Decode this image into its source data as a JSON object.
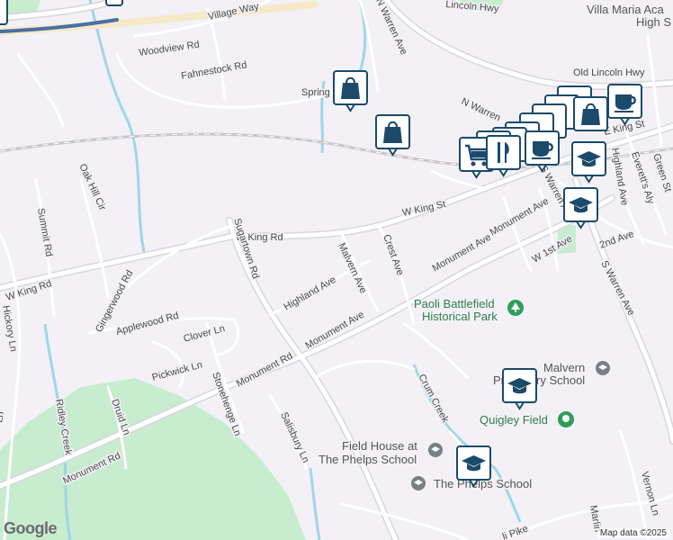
{
  "map": {
    "attribution": "Map data ©2025",
    "logo": "Google",
    "colors": {
      "background": "#f3f1f5",
      "road": "#ffffff",
      "road_casing": "#d9d6de",
      "water": "#9fd6e8",
      "park": "#c8eccf",
      "rail": "#c9c6cf",
      "marker_fill": "#ffffff",
      "marker_border": "#1b4a6b",
      "marker_icon": "#1b4a6b",
      "transit": "#4a6fa5"
    }
  },
  "streets": [
    {
      "text": "Village Way"
    },
    {
      "text": "Woodview Rd"
    },
    {
      "text": "Fahnestock Rd"
    },
    {
      "text": "N Warren Ave"
    },
    {
      "text": "Lincoln Hwy"
    },
    {
      "text": "Old Lincoln Hwy"
    },
    {
      "text": "Spring"
    },
    {
      "text": "N Warren"
    },
    {
      "text": "E King St"
    },
    {
      "text": "W King St"
    },
    {
      "text": "W King Rd"
    },
    {
      "text": "W King Rd"
    },
    {
      "text": "Oak Hill Cir"
    },
    {
      "text": "Summit Rd"
    },
    {
      "text": "Sugartown Rd"
    },
    {
      "text": "Malvern Ave"
    },
    {
      "text": "Crest Ave"
    },
    {
      "text": "Highland Ave"
    },
    {
      "text": "Monument Ave"
    },
    {
      "text": "Monument Ave"
    },
    {
      "text": "Monument Ave"
    },
    {
      "text": "Monument Rd"
    },
    {
      "text": "Monument Rd"
    },
    {
      "text": "Gingerwood Rd"
    },
    {
      "text": "Applewood Rd"
    },
    {
      "text": "Clover Ln"
    },
    {
      "text": "Pickwick Ln"
    },
    {
      "text": "Stonehenge Ln"
    },
    {
      "text": "Druid Ln"
    },
    {
      "text": "Salisbury Ln"
    },
    {
      "text": "Ridley Creek"
    },
    {
      "text": "Crum Creek"
    },
    {
      "text": "Hickory Ln"
    },
    {
      "text": "Ln"
    },
    {
      "text": "W 1st Ave"
    },
    {
      "text": "2nd Ave"
    },
    {
      "text": "S Warren Ave"
    },
    {
      "text": "S Warren Ave"
    },
    {
      "text": "Everett's Aly"
    },
    {
      "text": "Green St"
    },
    {
      "text": "Highland Ave"
    },
    {
      "text": "Vernon Ln"
    },
    {
      "text": "Marlin"
    },
    {
      "text": "li Pike"
    }
  ],
  "pois": [
    {
      "text": "Villa Maria Aca"
    },
    {
      "text": "High S"
    },
    {
      "text": "Paoli Battlefield"
    },
    {
      "text": "Historical Park"
    },
    {
      "text": "Malvern"
    },
    {
      "text": "Prep"
    },
    {
      "text": "ry School"
    },
    {
      "text": "Quigley Field"
    },
    {
      "text": "Field House at"
    },
    {
      "text": "The Phelps School"
    },
    {
      "text": "The Phelps School"
    }
  ],
  "markers": [
    {
      "icon": "shopping-bag-icon"
    },
    {
      "icon": "shopping-bag-icon"
    },
    {
      "icon": "shopping-cart-icon"
    },
    {
      "icon": "restaurant-icon"
    },
    {
      "icon": "coffee-cup-icon"
    },
    {
      "icon": "coffee-cup-icon"
    },
    {
      "icon": "shopping-bag-icon"
    },
    {
      "icon": "graduation-cap-icon"
    },
    {
      "icon": "graduation-cap-icon"
    },
    {
      "icon": "graduation-cap-icon"
    },
    {
      "icon": "graduation-cap-icon"
    }
  ]
}
